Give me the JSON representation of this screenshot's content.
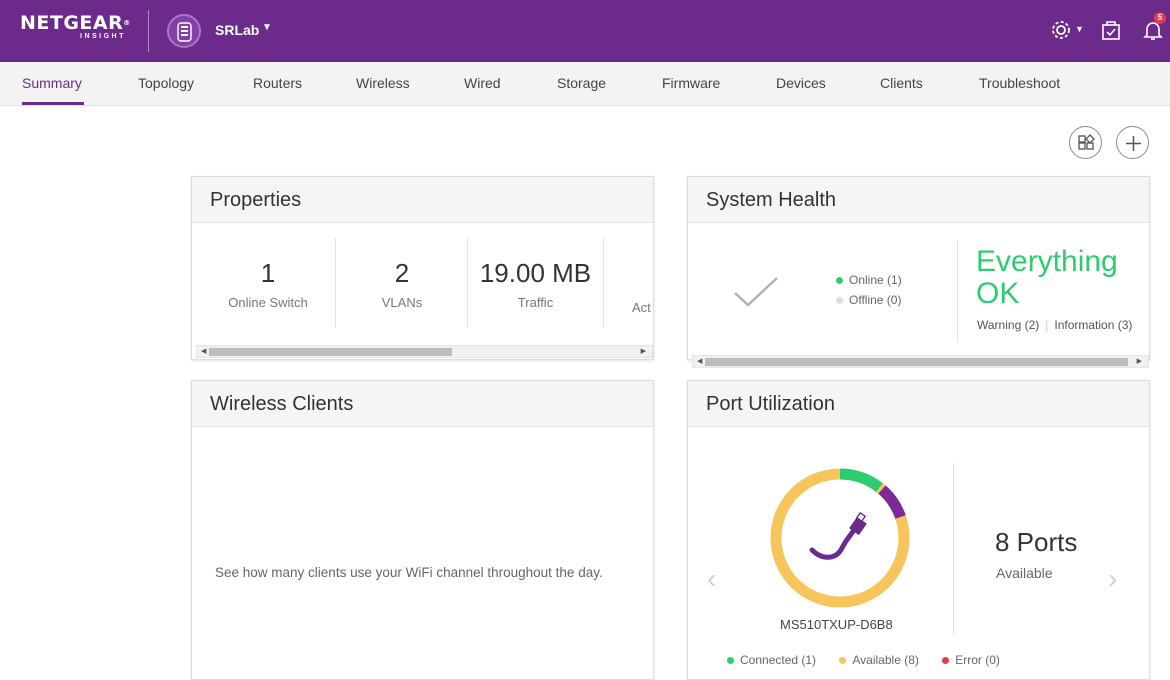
{
  "header": {
    "brand": "NETGEAR",
    "brand_sub": "INSIGHT",
    "location": "SRLab",
    "notification_count": "5"
  },
  "tabs": [
    {
      "label": "Summary"
    },
    {
      "label": "Topology"
    },
    {
      "label": "Routers"
    },
    {
      "label": "Wireless"
    },
    {
      "label": "Wired"
    },
    {
      "label": "Storage"
    },
    {
      "label": "Firmware"
    },
    {
      "label": "Devices"
    },
    {
      "label": "Clients"
    },
    {
      "label": "Troubleshoot"
    }
  ],
  "properties": {
    "title": "Properties",
    "items": [
      {
        "value": "1",
        "label": "Online Switch"
      },
      {
        "value": "2",
        "label": "VLANs"
      },
      {
        "value": "19.00 MB",
        "label": "Traffic"
      },
      {
        "value": "",
        "label": "Act"
      }
    ],
    "scroll_fraction": 0.56
  },
  "system_health": {
    "title": "System Health",
    "online": "Online (1)",
    "offline": "Offline (0)",
    "status_line1": "Everything",
    "status_line2": "OK",
    "warning": "Warning (2)",
    "information": "Information (3)"
  },
  "wireless_clients": {
    "title": "Wireless Clients",
    "message": "See how many clients use your WiFi channel throughout the day."
  },
  "port_utilization": {
    "title": "Port Utilization",
    "ports": "8 Ports",
    "ports_label": "Available",
    "device": "MS510TXUP-D6B8",
    "legend": [
      {
        "label": "Connected (1)",
        "color": "#2ecc71"
      },
      {
        "label": "Available (8)",
        "color": "#f6c55c"
      },
      {
        "label": "Error (0)",
        "color": "#e53950"
      }
    ]
  },
  "colors": {
    "brand": "#6c2a8b",
    "ok": "#2ecc71",
    "available": "#f6c55c",
    "purple_segment": "#7b2a96"
  }
}
